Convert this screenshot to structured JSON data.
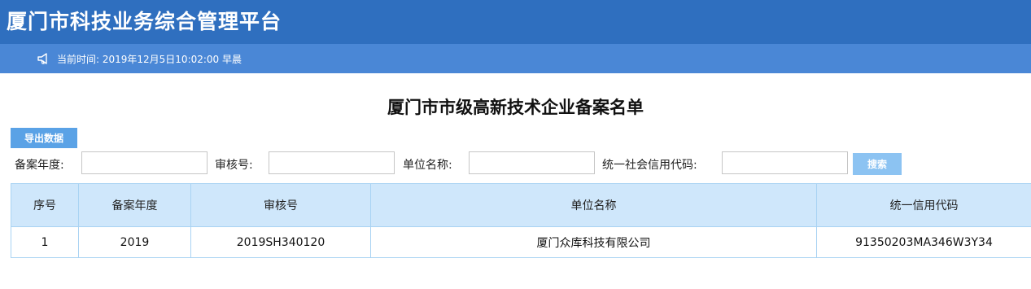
{
  "header": {
    "app_title": "厦门市科技业务综合管理平台",
    "time_label": "当前时间: 2019年12月5日10:02:00 早晨"
  },
  "main": {
    "page_title": "厦门市市级高新技术企业备案名单",
    "export_label": "导出数据",
    "filters": [
      {
        "label": "备案年度:",
        "value": "",
        "placeholder": ""
      },
      {
        "label": "审核号:",
        "value": "",
        "placeholder": ""
      },
      {
        "label": "单位名称:",
        "value": "",
        "placeholder": ""
      },
      {
        "label": "统一社会信用代码:",
        "value": "",
        "placeholder": ""
      }
    ],
    "search_label": "搜索",
    "table": {
      "columns": [
        "序号",
        "备案年度",
        "审核号",
        "单位名称",
        "统一信用代码"
      ],
      "rows": [
        [
          "1",
          "2019",
          "2019SH340120",
          "厦门众库科技有限公司",
          "91350203MA346W3Y34"
        ]
      ]
    }
  },
  "icons": {
    "speaker": "speaker-icon"
  },
  "colors": {
    "header_bg": "#2f6fbf",
    "subbar_bg": "#4a87d6",
    "table_header_bg": "#cfe7fb",
    "button_bg": "#5aa2e6"
  }
}
